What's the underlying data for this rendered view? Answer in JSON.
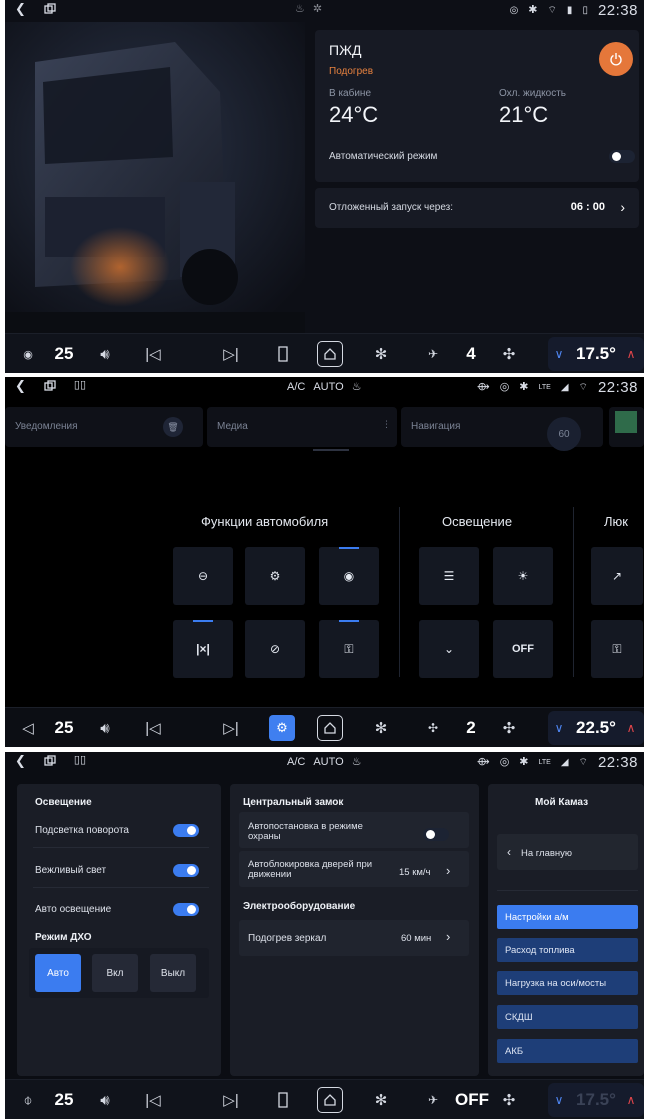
{
  "status": {
    "ac": "A/C",
    "auto": "AUTO",
    "time": "22:38",
    "network": "LTE"
  },
  "screen1": {
    "title": "ПЖД",
    "subtitle": "Подогрев",
    "cabin_label": "В кабине",
    "cabin_temp": "24°C",
    "coolant_label": "Охл. жидкость",
    "coolant_temp": "21°C",
    "auto_mode_label": "Автоматический режим",
    "auto_mode_on": false,
    "delayed_start_label": "Отложенный запуск через:",
    "delayed_start_value": "06 : 00",
    "accent_color": "#e5773a"
  },
  "screen2": {
    "widgets": [
      "Уведомления",
      "Медиа",
      "Навигация"
    ],
    "nav_speed": "60",
    "section_functions": "Функции автомобиля",
    "section_lighting": "Освещение",
    "section_sunroof": "Люк",
    "off_label": "OFF"
  },
  "screen3": {
    "lighting_title": "Освещение",
    "lighting_rows": [
      {
        "label": "Подсветка поворота",
        "on": true
      },
      {
        "label": "Вежливый свет",
        "on": true
      },
      {
        "label": "Авто освещение",
        "on": true
      }
    ],
    "drl_title": "Режим ДХО",
    "drl_options": [
      "Авто",
      "Вкл",
      "Выкл"
    ],
    "drl_selected": "Авто",
    "lock_title": "Центральный замок",
    "lock_row1": "Автопостановка в режиме охраны",
    "lock_row1_on": false,
    "lock_row2": "Автоблокировка дверей при движении",
    "lock_row2_value": "15 км/ч",
    "electro_title": "Электрооборудование",
    "mirror_label": "Подогрев зеркал",
    "mirror_value": "60 мин",
    "side_title": "Мой Камаз",
    "back_label": "На главную",
    "menu": [
      "Настройки а/м",
      "Расход топлива",
      "Нагрузка на оси/мосты",
      "СКДШ",
      "АКБ"
    ],
    "menu_selected": "Настройки а/м"
  },
  "bottom1": {
    "volume": "25",
    "fan": "4",
    "temp": "17.5°"
  },
  "bottom2": {
    "volume": "25",
    "fan": "2",
    "temp": "22.5°"
  },
  "bottom3": {
    "volume": "25",
    "fan": "OFF",
    "temp": "17.5°"
  },
  "colors": {
    "accent_blue": "#3b7cf0",
    "up_arrow_red": "#e0454a"
  }
}
